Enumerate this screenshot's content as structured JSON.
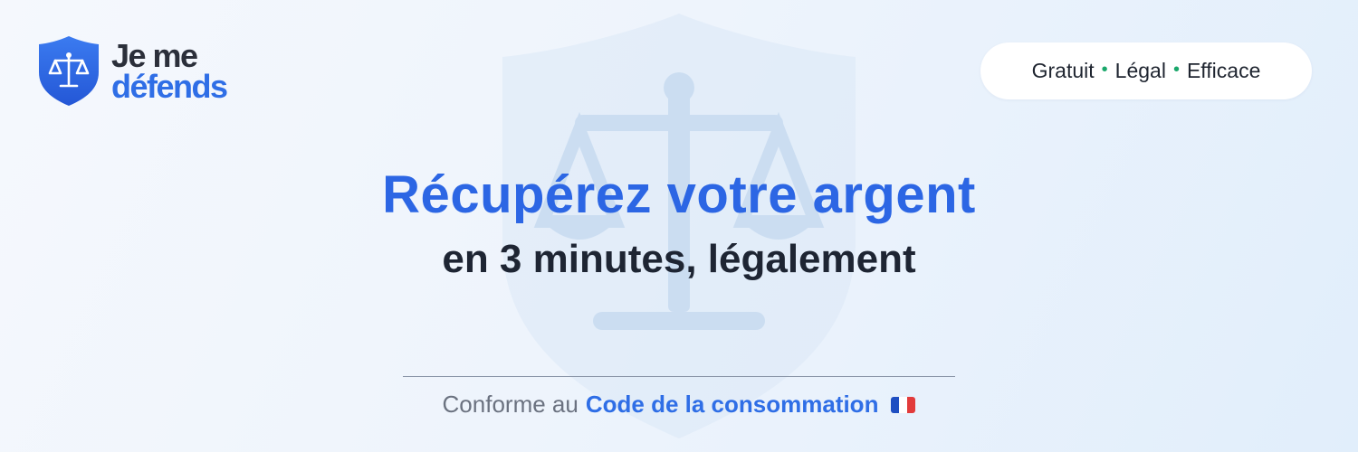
{
  "brand": {
    "line1": "Je me",
    "line2": "défends",
    "dark_color": "#2b2f3a",
    "blue_color": "#2f6ee6",
    "icon": "scales-shield-icon"
  },
  "badge": {
    "items": [
      "Gratuit",
      "Légal",
      "Efficace"
    ],
    "separator": "•",
    "dot_color": "#1aa76b",
    "text_color": "#1f2530"
  },
  "headline": {
    "text": "Récupérez votre argent",
    "color": "#2c66e4"
  },
  "subhead": {
    "text": "en 3 minutes, légalement",
    "color": "#1e2533"
  },
  "footer": {
    "prefix": "Conforme au",
    "strong": "Code de la consommation",
    "prefix_color": "#6b7280",
    "strong_color": "#2f6ee6",
    "flag_icon": "france-flag-icon",
    "flag_colors": [
      "#1f4fc2",
      "#ffffff",
      "#e23b3b"
    ]
  },
  "colors": {
    "background_start": "#f5f8fd",
    "background_end": "#e1eefb",
    "watermark": "#c9dcf1"
  }
}
